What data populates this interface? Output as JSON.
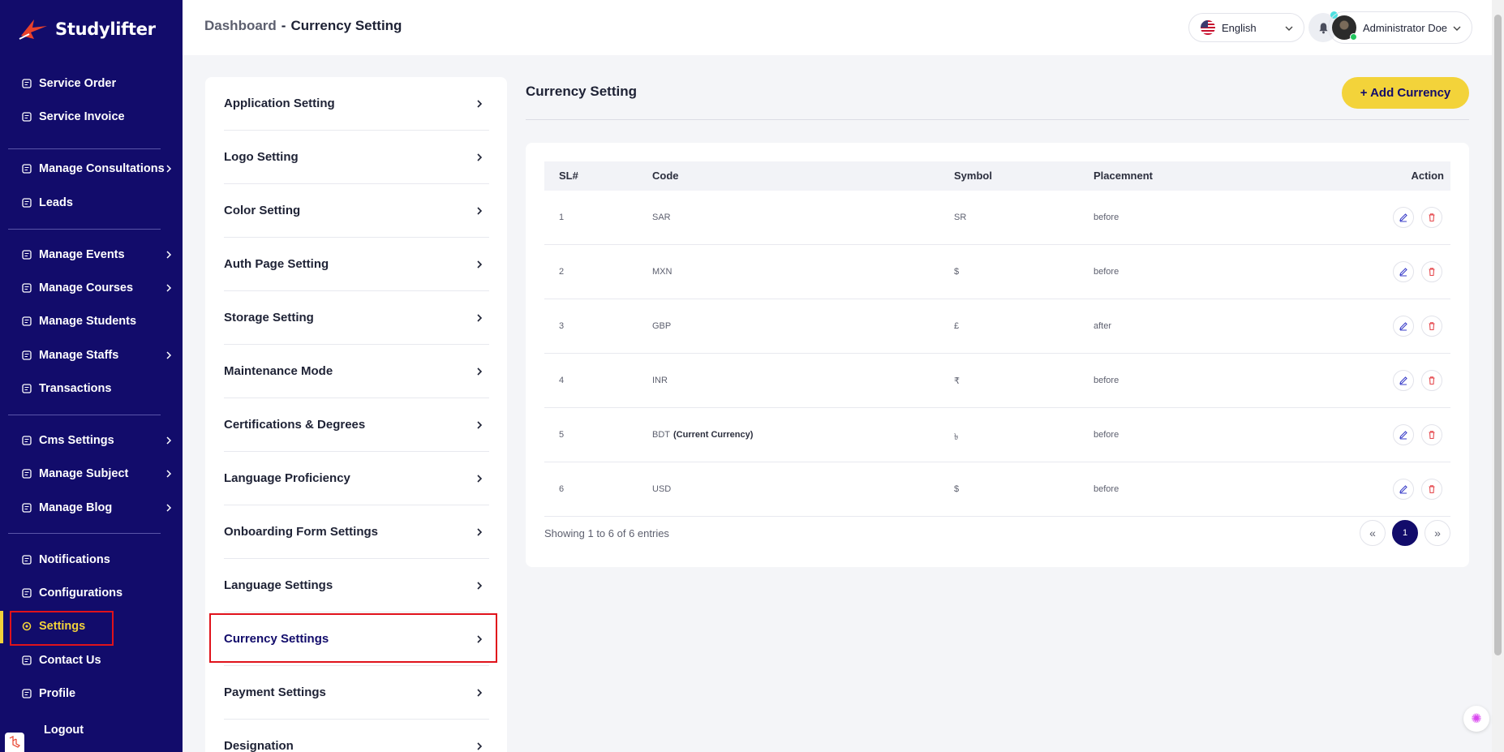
{
  "brand": {
    "name": "Studylifter"
  },
  "sidebar": {
    "items": [
      {
        "label": "Service Order",
        "icon": "list-icon"
      },
      {
        "label": "Service Invoice",
        "icon": "invoice-icon"
      },
      {
        "label": "Manage Consultations",
        "icon": "consultation-icon"
      },
      {
        "label": "Leads",
        "icon": "leads-icon"
      },
      {
        "label": "Manage Events",
        "icon": "calendar-icon"
      },
      {
        "label": "Manage Courses",
        "icon": "course-icon"
      },
      {
        "label": "Manage Students",
        "icon": "students-icon"
      },
      {
        "label": "Manage Staffs",
        "icon": "staff-icon"
      },
      {
        "label": "Transactions",
        "icon": "transactions-icon"
      },
      {
        "label": "Cms Settings",
        "icon": "cms-icon"
      },
      {
        "label": "Manage Subject",
        "icon": "subject-icon"
      },
      {
        "label": "Manage Blog",
        "icon": "blog-icon"
      },
      {
        "label": "Notifications",
        "icon": "bell-icon"
      },
      {
        "label": "Configurations",
        "icon": "config-icon"
      },
      {
        "label": "Settings",
        "icon": "gear-icon"
      },
      {
        "label": "Contact Us",
        "icon": "contact-icon"
      },
      {
        "label": "Profile",
        "icon": "user-icon"
      },
      {
        "label": "Logout",
        "icon": "logout-icon"
      }
    ]
  },
  "header": {
    "breadcrumb_root": "Dashboard",
    "breadcrumb_sep": "-",
    "breadcrumb_current": "Currency Setting",
    "language": "English",
    "user_name": "Administrator Doe"
  },
  "settings_menu": {
    "items": [
      "Application Setting",
      "Logo Setting",
      "Color Setting",
      "Auth Page Setting",
      "Storage Setting",
      "Maintenance Mode",
      "Certifications & Degrees",
      "Language Proficiency",
      "Onboarding Form Settings",
      "Language Settings",
      "Currency Settings",
      "Payment Settings",
      "Designation"
    ]
  },
  "content": {
    "title": "Currency Setting",
    "add_button": "+ Add Currency",
    "table": {
      "headers": [
        "SL#",
        "Code",
        "Symbol",
        "Placemnent",
        "Action"
      ],
      "rows": [
        {
          "sl": "1",
          "code": "SAR",
          "current": "",
          "symbol": "SR",
          "placement": "before"
        },
        {
          "sl": "2",
          "code": "MXN",
          "current": "",
          "symbol": "$",
          "placement": "before"
        },
        {
          "sl": "3",
          "code": "GBP",
          "current": "",
          "symbol": "£",
          "placement": "after"
        },
        {
          "sl": "4",
          "code": "INR",
          "current": "",
          "symbol": "₹",
          "placement": "before"
        },
        {
          "sl": "5",
          "code": "BDT",
          "current": "(Current Currency)",
          "symbol": "৳",
          "placement": "before"
        },
        {
          "sl": "6",
          "code": "USD",
          "current": "",
          "symbol": "$",
          "placement": "before"
        }
      ]
    },
    "showing": "Showing 1 to 6 of 6 entries",
    "pagination": {
      "prev": "«",
      "page": "1",
      "next": "»"
    }
  },
  "colors": {
    "sidebar_bg": "#120c6b",
    "accent_yellow": "#f3d33a",
    "highlight_red": "#e0121b"
  }
}
